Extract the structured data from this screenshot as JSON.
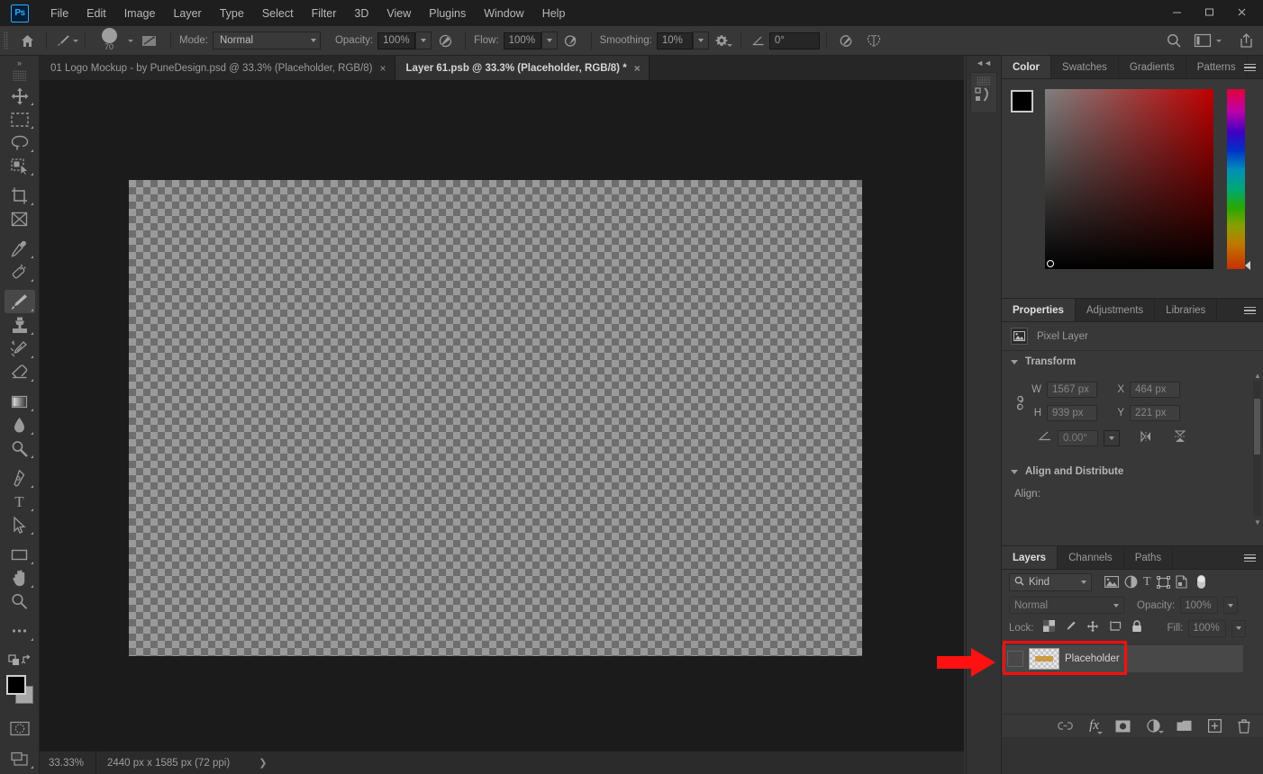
{
  "app": {
    "logo": "Ps",
    "menus": [
      "File",
      "Edit",
      "Image",
      "Layer",
      "Type",
      "Select",
      "Filter",
      "3D",
      "View",
      "Plugins",
      "Window",
      "Help"
    ],
    "window_controls": [
      "minimize-button",
      "maximize-button",
      "close-button"
    ],
    "accent_highlight": "#ff0d0d"
  },
  "options_bar": {
    "home_icon": "home-icon",
    "brush_preset_icon": "brush-icon",
    "brush_size": "70",
    "brush_panel_icon": "brush-settings-icon",
    "mode_label": "Mode:",
    "mode_value": "Normal",
    "opacity_label": "Opacity:",
    "opacity_value": "100%",
    "pressure_opacity_icon": "pressure-opacity-icon",
    "flow_label": "Flow:",
    "flow_value": "100%",
    "airbrush_icon": "airbrush-icon",
    "smoothing_label": "Smoothing:",
    "smoothing_value": "10%",
    "smoothing_options_icon": "gear-icon",
    "angle_icon": "angle-icon",
    "angle_value": "0°",
    "pressure_size_icon": "pressure-size-icon",
    "symmetry_icon": "butterfly-symmetry-icon",
    "search_icon": "search-icon",
    "workspace_icon": "workspace-icon",
    "share_icon": "share-icon"
  },
  "tabs": [
    {
      "title": "01 Logo Mockup - by PuneDesign.psd @ 33.3% (Placeholder, RGB/8)",
      "active": false,
      "close": "×"
    },
    {
      "title": "Layer 61.psb @ 33.3% (Placeholder, RGB/8) *",
      "active": true,
      "close": "×"
    }
  ],
  "toolbar": {
    "collapse_label": "»",
    "tools": [
      {
        "name": "move-tool",
        "selected": false,
        "has_flyout": true
      },
      {
        "name": "rectangular-marquee-tool",
        "selected": false,
        "has_flyout": true
      },
      {
        "name": "lasso-tool",
        "selected": false,
        "has_flyout": true
      },
      {
        "name": "object-selection-tool",
        "selected": false,
        "has_flyout": true
      },
      {
        "name": "crop-tool",
        "selected": false,
        "has_flyout": true
      },
      {
        "name": "frame-tool",
        "selected": false,
        "has_flyout": false
      },
      {
        "name": "eyedropper-tool",
        "selected": false,
        "has_flyout": true
      },
      {
        "name": "spot-healing-brush-tool",
        "selected": false,
        "has_flyout": true
      },
      {
        "name": "brush-tool",
        "selected": true,
        "has_flyout": true
      },
      {
        "name": "clone-stamp-tool",
        "selected": false,
        "has_flyout": true
      },
      {
        "name": "history-brush-tool",
        "selected": false,
        "has_flyout": true
      },
      {
        "name": "eraser-tool",
        "selected": false,
        "has_flyout": true
      },
      {
        "name": "gradient-tool",
        "selected": false,
        "has_flyout": true
      },
      {
        "name": "blur-tool",
        "selected": false,
        "has_flyout": true
      },
      {
        "name": "dodge-tool",
        "selected": false,
        "has_flyout": true
      },
      {
        "name": "pen-tool",
        "selected": false,
        "has_flyout": true
      },
      {
        "name": "type-tool",
        "selected": false,
        "has_flyout": true
      },
      {
        "name": "path-selection-tool",
        "selected": false,
        "has_flyout": true
      },
      {
        "name": "rectangle-tool",
        "selected": false,
        "has_flyout": true
      },
      {
        "name": "hand-tool",
        "selected": false,
        "has_flyout": true
      },
      {
        "name": "zoom-tool",
        "selected": false,
        "has_flyout": false
      },
      {
        "name": "edit-toolbar-tool",
        "selected": false,
        "has_flyout": true
      }
    ],
    "foreground_color": "#000000",
    "background_color": "#a0a0a0",
    "quick_mask_icon": "quick-mask-icon",
    "screen_mode_icon": "screen-mode-icon"
  },
  "canvas": {
    "document_is_transparent": true
  },
  "status_bar": {
    "zoom": "33.33%",
    "doc_info": "2440 px x 1585 px (72 ppi)",
    "expand_arrow": "❯"
  },
  "mini_dock": {
    "collapse_label": "◄◄",
    "icon": "history-actions-icon"
  },
  "dock": {
    "collapse_label": "►►",
    "color_panel": {
      "tabs": [
        {
          "label": "Color",
          "active": true
        },
        {
          "label": "Swatches",
          "active": false
        },
        {
          "label": "Gradients",
          "active": false
        },
        {
          "label": "Patterns",
          "active": false
        }
      ],
      "menu_icon": "panel-menu-icon",
      "foreground_color": "#000000",
      "background_color": "#a0a0a0"
    },
    "properties_panel": {
      "tabs": [
        {
          "label": "Properties",
          "active": true
        },
        {
          "label": "Adjustments",
          "active": false
        },
        {
          "label": "Libraries",
          "active": false
        }
      ],
      "menu_icon": "panel-menu-icon",
      "layer_type": "Pixel Layer",
      "layer_type_icon": "pixel-layer-icon",
      "transform": {
        "title": "Transform",
        "link_icon": "link-dimensions-icon",
        "w_label": "W",
        "w_value": "1567 px",
        "x_label": "X",
        "x_value": "464 px",
        "h_label": "H",
        "h_value": "939 px",
        "y_label": "Y",
        "y_value": "221 px",
        "angle_icon": "angle-icon",
        "angle_value": "0.00°",
        "flip_horizontal_icon": "flip-horizontal-icon",
        "flip_vertical_icon": "flip-vertical-icon"
      },
      "align": {
        "title": "Align and Distribute",
        "align_label": "Align:"
      }
    },
    "layers_panel": {
      "tabs": [
        {
          "label": "Layers",
          "active": true
        },
        {
          "label": "Channels",
          "active": false
        },
        {
          "label": "Paths",
          "active": false
        }
      ],
      "menu_icon": "panel-menu-icon",
      "filter_label": "Kind",
      "filter_search_icon": "search-icon",
      "filter_icons": [
        "filter-pixel-icon",
        "filter-adjustment-icon",
        "filter-type-icon",
        "filter-shape-icon",
        "filter-smartobject-icon"
      ],
      "filter_toggle_icon": "filter-toggle-icon",
      "blend_mode": "Normal",
      "opacity_label": "Opacity:",
      "opacity_value": "100%",
      "lock_label": "Lock:",
      "lock_icons": [
        "lock-transparent-pixels-icon",
        "lock-image-pixels-icon",
        "lock-position-icon",
        "lock-artboard-nesting-icon",
        "lock-all-icon"
      ],
      "fill_label": "Fill:",
      "fill_value": "100%",
      "layers": [
        {
          "name": "Placeholder",
          "visible": false,
          "selected": true,
          "highlighted": true
        }
      ],
      "footer_buttons": [
        "link-layers-icon",
        "layer-style-fx-icon",
        "add-layer-mask-icon",
        "new-fill-adjustment-layer-icon",
        "new-group-icon",
        "new-layer-icon",
        "delete-layer-icon"
      ]
    }
  }
}
